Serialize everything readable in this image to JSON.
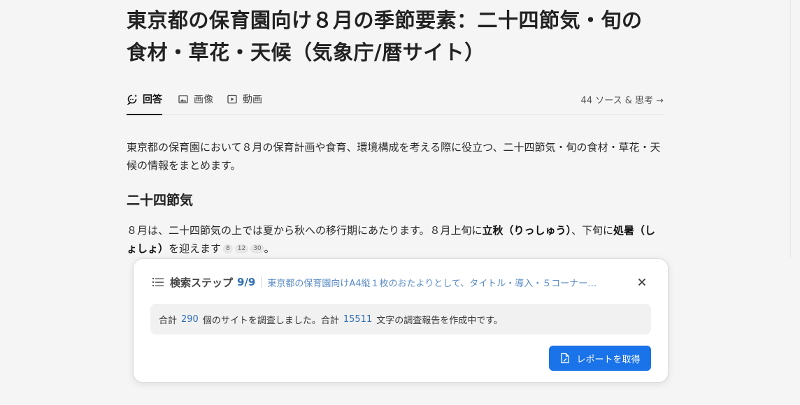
{
  "page": {
    "title_line1": "東京都の保育園向け８月の季節要素：二十四節気・旬の",
    "title_line2": "食材・草花・天候（気象庁/暦サイト）"
  },
  "tabs": [
    {
      "label": "回答",
      "icon": "sparkle-chat-icon"
    },
    {
      "label": "画像",
      "icon": "image-icon"
    },
    {
      "label": "動画",
      "icon": "video-play-icon"
    }
  ],
  "sources_link": "44 ソース & 思考 →",
  "intro": "東京都の保育園において８月の保育計画や食育、環境構成を考える際に役立つ、二十四節気・旬の食材・草花・天候の情報をまとめます。",
  "section_heading": "二十四節気",
  "para": {
    "part1": "８月は、二十四節気の上では夏から秋への移行期にあたります。８月上旬に",
    "bold1": "立秋（りっしゅう）",
    "part2": "、下旬に",
    "bold2": "処暑（しょしょ）",
    "part3": "を迎えます",
    "citations": [
      "8",
      "12",
      "30"
    ],
    "end": "。"
  },
  "panel": {
    "title": "検索ステップ",
    "count": "9/9",
    "query": "東京都の保育園向けA4縦１枚のおたよりとして、タイトル・導入・５コーナー…",
    "status_prefix": "合計",
    "sites_count": "290",
    "status_mid": "個のサイトを調査しました。合計",
    "chars_count": "15511",
    "status_suffix": "文字の調査報告を作成中です。",
    "report_button": "レポートを取得"
  },
  "colors": {
    "accent": "#1a73e8",
    "link_blue": "#2f6fb6",
    "background": "#f5f5f5"
  }
}
